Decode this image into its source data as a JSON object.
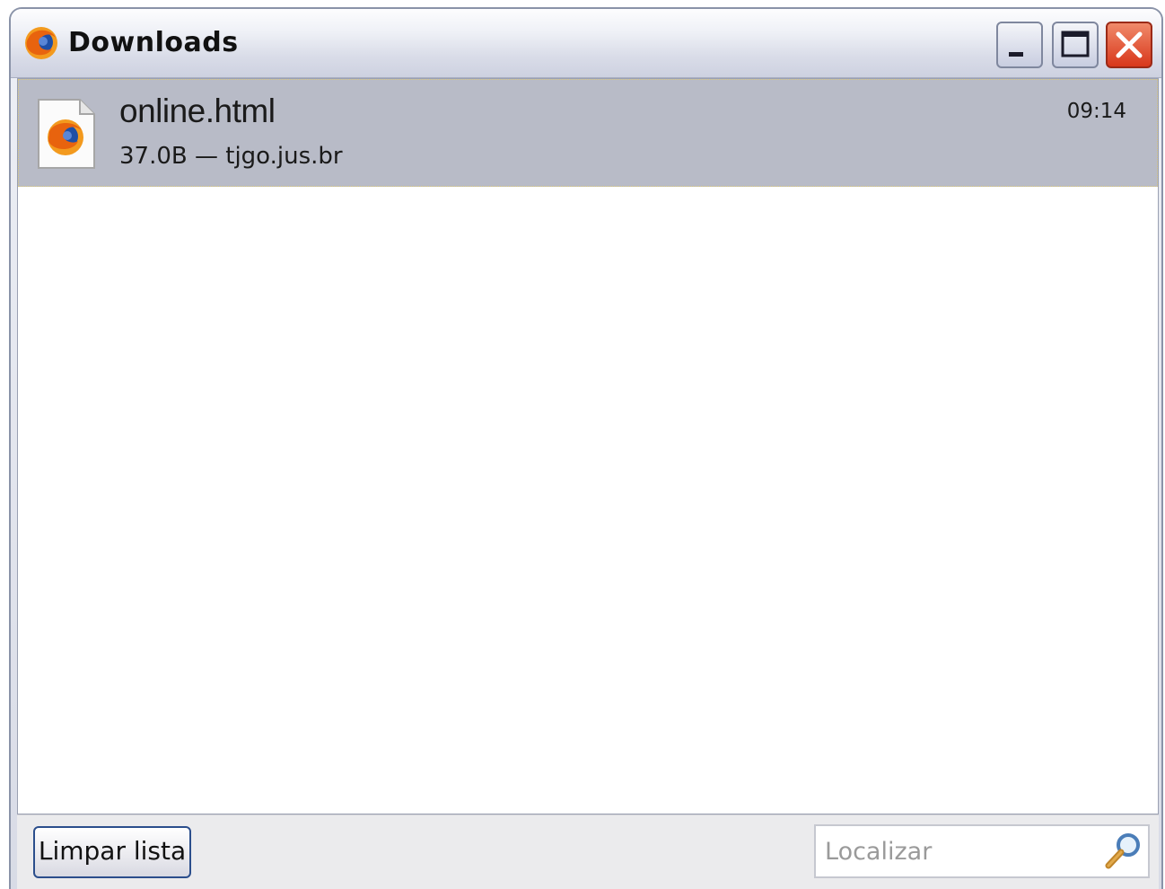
{
  "window": {
    "title": "Downloads",
    "icon": "firefox-icon",
    "controls": [
      "minimize-icon",
      "maximize-icon",
      "close-icon"
    ]
  },
  "downloads": [
    {
      "name": "online.html",
      "meta": "37.0B — tjgo.jus.br",
      "time": "09:14",
      "icon": "firefox-file-icon"
    }
  ],
  "footer": {
    "clear_label": "Limpar lista",
    "search_placeholder": "Localizar",
    "search_value": "",
    "search_icon": "search-icon"
  },
  "colors": {
    "selected_row": "#b8bbc7",
    "close_button": "#d8371b",
    "button_border": "#2b4e8c"
  }
}
